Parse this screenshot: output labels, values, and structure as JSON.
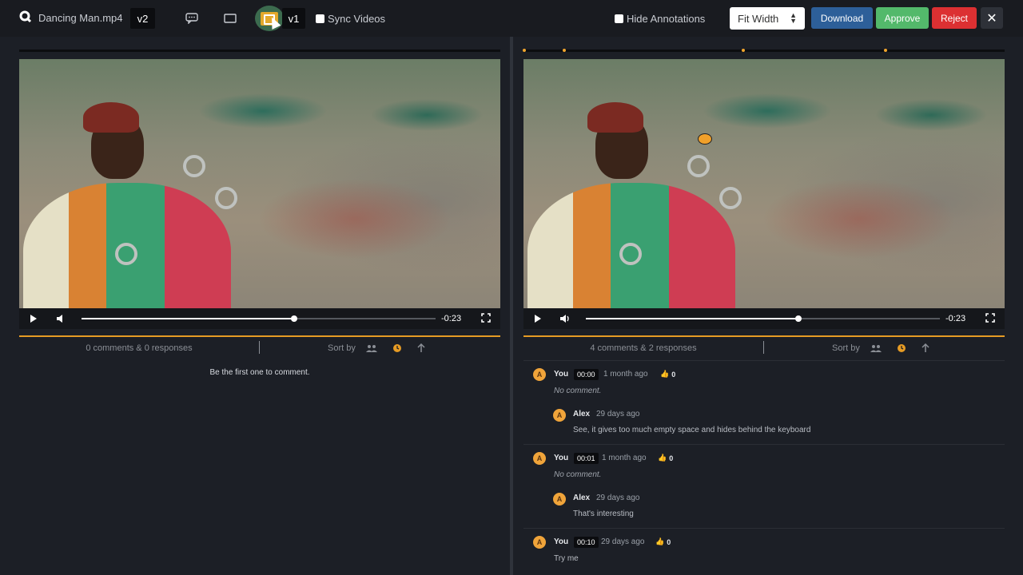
{
  "toolbar": {
    "filename": "Dancing Man.mp4",
    "left_version": "v2",
    "right_version": "v1",
    "sync_label": "Sync Videos",
    "hide_label": "Hide Annotations",
    "fit_select": "Fit Width",
    "download_label": "Download",
    "approve_label": "Approve",
    "reject_label": "Reject",
    "close_label": "✕"
  },
  "left": {
    "time_remaining": "-0:23",
    "progress": 0.6,
    "comment_count": "0 comments & 0 responses",
    "sort_label": "Sort by",
    "empty_text": "Be the first one to comment."
  },
  "right": {
    "time_remaining": "-0:23",
    "progress": 0.6,
    "comment_count": "4 comments & 2 responses",
    "sort_label": "Sort by",
    "threads": [
      {
        "author": "You",
        "avatar": "A",
        "timestamp": "00:00",
        "ago": "1 month ago",
        "likes": "0",
        "text": "No comment.",
        "reply": {
          "author": "Alex",
          "avatar": "A",
          "ago": "29 days ago",
          "text": "See, it gives too much empty space and hides behind the keyboard"
        }
      },
      {
        "author": "You",
        "avatar": "A",
        "timestamp": "00:01",
        "ago": "1 month ago",
        "likes": "0",
        "text": "No comment.",
        "reply": {
          "author": "Alex",
          "avatar": "A",
          "ago": "29 days ago",
          "text": "That's interesting"
        }
      },
      {
        "author": "You",
        "avatar": "A",
        "timestamp": "00:10",
        "ago": "29 days ago",
        "likes": "0",
        "text": "Try me"
      }
    ]
  },
  "colors": {
    "accent": "#e69b24",
    "download": "#2d5f99",
    "approve": "#53b96b",
    "reject": "#dc3032"
  }
}
